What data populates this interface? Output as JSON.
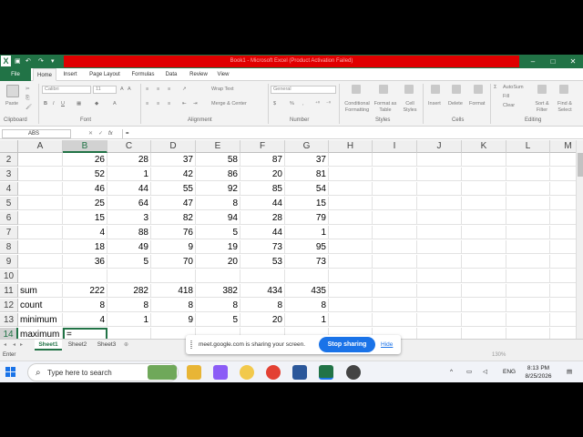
{
  "window": {
    "title": "Book1 - Microsoft Excel (Product Activation Failed)",
    "app_icon": "X",
    "controls": [
      "–",
      "□",
      "✕"
    ]
  },
  "ribbon": {
    "tabs": [
      "File",
      "Home",
      "Insert",
      "Page Layout",
      "Formulas",
      "Data",
      "Review",
      "View"
    ],
    "active_tab": "Home",
    "clipboard": {
      "paste": "Paste",
      "label": "Clipboard"
    },
    "font": {
      "name": "Calibri",
      "size": "11",
      "label": "Font"
    },
    "alignment": {
      "wrap": "Wrap Text",
      "merge": "Merge & Center",
      "label": "Alignment"
    },
    "number": {
      "format": "General",
      "label": "Number",
      "currency": "$",
      "percent": "%",
      "comma": ","
    },
    "styles": {
      "conditional": "Conditional Formatting",
      "format_table": "Format as Table",
      "cell_styles": "Cell Styles",
      "label": "Styles"
    },
    "cells": {
      "insert": "Insert",
      "delete": "Delete",
      "format": "Format",
      "label": "Cells"
    },
    "editing": {
      "autosum": "AutoSum",
      "fill": "Fill",
      "clear": "Clear",
      "sort": "Sort & Filter",
      "find": "Find & Select",
      "label": "Editing"
    }
  },
  "formula_bar": {
    "name_box": "ABS",
    "fx": "fx",
    "cancel": "✕",
    "enter": "✓",
    "content": "="
  },
  "sheet": {
    "columns": [
      "A",
      "B",
      "C",
      "D",
      "E",
      "F",
      "G",
      "H",
      "I",
      "J",
      "K",
      "L",
      "M"
    ],
    "selected_column": "B",
    "selected_row": "14",
    "rows": [
      {
        "n": "2",
        "a": "",
        "v": [
          "26",
          "28",
          "37",
          "58",
          "87",
          "37"
        ]
      },
      {
        "n": "3",
        "a": "",
        "v": [
          "52",
          "1",
          "42",
          "86",
          "20",
          "81"
        ]
      },
      {
        "n": "4",
        "a": "",
        "v": [
          "46",
          "44",
          "55",
          "92",
          "85",
          "54"
        ]
      },
      {
        "n": "5",
        "a": "",
        "v": [
          "25",
          "64",
          "47",
          "8",
          "44",
          "15"
        ]
      },
      {
        "n": "6",
        "a": "",
        "v": [
          "15",
          "3",
          "82",
          "94",
          "28",
          "79"
        ]
      },
      {
        "n": "7",
        "a": "",
        "v": [
          "4",
          "88",
          "76",
          "5",
          "44",
          "1"
        ]
      },
      {
        "n": "8",
        "a": "",
        "v": [
          "18",
          "49",
          "9",
          "19",
          "73",
          "95"
        ]
      },
      {
        "n": "9",
        "a": "",
        "v": [
          "36",
          "5",
          "70",
          "20",
          "53",
          "73"
        ]
      },
      {
        "n": "10",
        "a": "",
        "v": [
          "",
          "",
          "",
          "",
          "",
          ""
        ]
      },
      {
        "n": "11",
        "a": "sum",
        "v": [
          "222",
          "282",
          "418",
          "382",
          "434",
          "435"
        ]
      },
      {
        "n": "12",
        "a": "count",
        "v": [
          "8",
          "8",
          "8",
          "8",
          "8",
          "8"
        ]
      },
      {
        "n": "13",
        "a": "minimum",
        "v": [
          "4",
          "1",
          "9",
          "5",
          "20",
          "1"
        ]
      },
      {
        "n": "14",
        "a": "maximum",
        "v": [
          "=",
          "",
          "",
          "",
          "",
          ""
        ]
      },
      {
        "n": "15",
        "a": "",
        "v": [
          "",
          "",
          "",
          "",
          "",
          ""
        ]
      }
    ],
    "active_cell_text": "="
  },
  "sheet_tabs": [
    "Sheet1",
    "Sheet2",
    "Sheet3"
  ],
  "active_sheet": "Sheet1",
  "status": {
    "mode": "Enter",
    "zoom": "130%"
  },
  "share_banner": {
    "message": "meet.google.com is sharing your screen.",
    "stop": "Stop sharing",
    "hide": "Hide"
  },
  "taskbar": {
    "search_placeholder": "Type here to search",
    "language": "ENG",
    "time": "8:13 PM",
    "date": "8/25/2026"
  }
}
